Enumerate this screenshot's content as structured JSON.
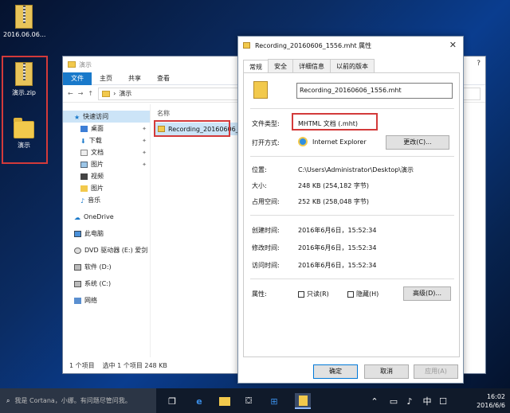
{
  "desktop": {
    "top_icon_label": "2016.06.06...",
    "zip_icon_label": "演示.zip",
    "folder_icon_label": "演示"
  },
  "explorer": {
    "title": "演示",
    "ribbon_tabs": [
      "文件",
      "主页",
      "共享",
      "查看"
    ],
    "address": "演示",
    "nav_items": [
      {
        "label": "快速访问",
        "icon": "star-icon",
        "selected": true
      },
      {
        "label": "桌面",
        "icon": "desktop-icon",
        "pinned": true
      },
      {
        "label": "下载",
        "icon": "download-icon",
        "pinned": true
      },
      {
        "label": "文档",
        "icon": "document-icon",
        "pinned": true
      },
      {
        "label": "图片",
        "icon": "picture-icon",
        "pinned": true
      },
      {
        "label": "视频",
        "icon": "video-icon"
      },
      {
        "label": "图片",
        "icon": "folder-icon"
      },
      {
        "label": "音乐",
        "icon": "music-icon"
      },
      {
        "label": "OneDrive",
        "icon": "cloud-icon"
      },
      {
        "label": "此电脑",
        "icon": "computer-icon"
      },
      {
        "label": "DVD 驱动器 (E:) 爱剑",
        "icon": "dvd-icon"
      },
      {
        "label": "软件 (D:)",
        "icon": "drive-icon"
      },
      {
        "label": "系统 (C:)",
        "icon": "drive-icon"
      },
      {
        "label": "网络",
        "icon": "network-icon"
      }
    ],
    "column_header": "名称",
    "file_name": "Recording_20160606_1",
    "status": [
      "1 个项目",
      "选中 1 个项目  248 KB"
    ]
  },
  "properties": {
    "title": "Recording_20160606_1556.mht 属性",
    "tabs": [
      "常规",
      "安全",
      "详细信息",
      "以前的版本"
    ],
    "file_name": "Recording_20160606_1556.mht",
    "type_label": "文件类型:",
    "type_value": "MHTML 文档 (.mht)",
    "open_with_label": "打开方式:",
    "open_with_value": "Internet Explorer",
    "change_button": "更改(C)...",
    "location_label": "位置:",
    "location_value": "C:\\Users\\Administrator\\Desktop\\演示",
    "size_label": "大小:",
    "size_value": "248 KB (254,182 字节)",
    "size_on_disk_label": "占用空间:",
    "size_on_disk_value": "252 KB (258,048 字节)",
    "created_label": "创建时间:",
    "created_value": "2016年6月6日，15:52:34",
    "modified_label": "修改时间:",
    "modified_value": "2016年6月6日，15:52:34",
    "accessed_label": "访问时间:",
    "accessed_value": "2016年6月6日，15:52:34",
    "attributes_label": "属性:",
    "readonly_label": "只读(R)",
    "hidden_label": "隐藏(H)",
    "advanced_button": "高级(D)...",
    "ok_button": "确定",
    "cancel_button": "取消",
    "apply_button": "应用(A)"
  },
  "taskbar": {
    "search_placeholder": "我是 Cortana，小娜。有问题尽管问我。",
    "time": "16:02",
    "date": "2016/6/6"
  },
  "colors": {
    "highlight": "#d33a3a",
    "accent": "#1979ca"
  }
}
